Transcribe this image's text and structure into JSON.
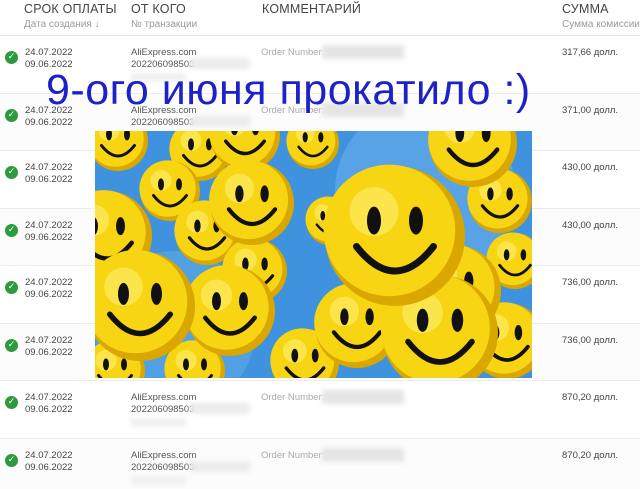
{
  "header": {
    "col_date": "СРОК ОПЛАТЫ",
    "col_date_sub": "Дата создания ↓",
    "col_from": "ОТ КОГО",
    "col_from_sub": "№ транзакции",
    "col_comment": "КОММЕНТАРИЙ",
    "col_sum": "СУММА",
    "col_sum_sub": "Сумма комиссии"
  },
  "rows": [
    {
      "due": "24.07.2022",
      "created": "09.06.2022",
      "from": "AliExpress.com",
      "tx": "202206098503",
      "comment": "Order Number:",
      "amount": "317,66 долл."
    },
    {
      "due": "24.07.2022",
      "created": "09.06.2022",
      "from": "AliExpress.com",
      "tx": "202206098503",
      "comment": "Order Number:",
      "amount": "371,00 долл."
    },
    {
      "due": "24.07.2022",
      "created": "09.06.2022",
      "from": "",
      "tx": "",
      "comment": "",
      "amount": "430,00 долл."
    },
    {
      "due": "24.07.2022",
      "created": "09.06.2022",
      "from": "",
      "tx": "",
      "comment": "",
      "amount": "430,00 долл."
    },
    {
      "due": "24.07.2022",
      "created": "09.06.2022",
      "from": "",
      "tx": "",
      "comment": "",
      "amount": "736,00 долл."
    },
    {
      "due": "24.07.2022",
      "created": "09.06.2022",
      "from": "",
      "tx": "",
      "comment": "",
      "amount": "736,00 долл."
    },
    {
      "due": "24.07.2022",
      "created": "09.06.2022",
      "from": "AliExpress.com",
      "tx": "202206098503",
      "comment": "Order Number:",
      "amount": "870,20 долл."
    },
    {
      "due": "24.07.2022",
      "created": "09.06.2022",
      "from": "AliExpress.com",
      "tx": "202206098503",
      "comment": "Order Number:",
      "amount": "870,20 долл."
    }
  ],
  "overlay": {
    "caption": "9-ого июня прокатило :)"
  },
  "colors": {
    "check": "#2e9a3e",
    "caption": "#1c22c7",
    "sky": "#3f93de",
    "smiley": "#f7d513"
  }
}
